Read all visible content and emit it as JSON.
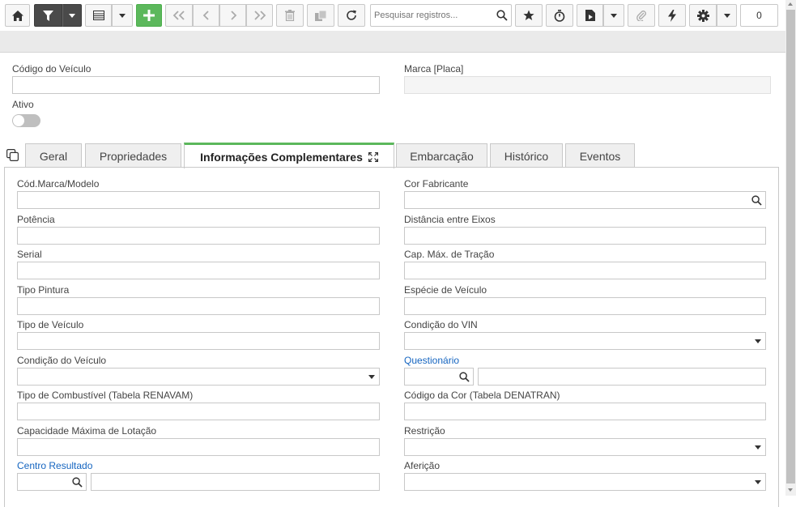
{
  "toolbar": {
    "search_placeholder": "Pesquisar registros...",
    "record_count": "0",
    "icons": [
      "home-icon",
      "filter-icon",
      "list-view-icon",
      "add-icon",
      "first-record-icon",
      "previous-record-icon",
      "next-record-icon",
      "last-record-icon",
      "delete-icon",
      "copy-icon",
      "refresh-icon",
      "search-icon",
      "favorite-star-icon",
      "timer-icon",
      "report-icon",
      "attachment-icon",
      "lightning-icon",
      "gear-icon"
    ]
  },
  "header": {
    "codigo_label": "Código do Veículo",
    "codigo_value": "",
    "marca_label": "Marca [Placa]",
    "marca_value": "",
    "ativo_label": "Ativo"
  },
  "tabs": [
    {
      "label": "Geral"
    },
    {
      "label": "Propriedades"
    },
    {
      "label": "Informações Complementares"
    },
    {
      "label": "Embarcação"
    },
    {
      "label": "Histórico"
    },
    {
      "label": "Eventos"
    }
  ],
  "form": {
    "left": [
      {
        "label": "Cód.Marca/Modelo",
        "value": ""
      },
      {
        "label": "Potência",
        "value": ""
      },
      {
        "label": "Serial",
        "value": ""
      },
      {
        "label": "Tipo Pintura",
        "value": ""
      },
      {
        "label": "Tipo de Veículo",
        "value": ""
      },
      {
        "label": "Condição do Veículo",
        "value": ""
      },
      {
        "label": "Tipo de Combustível (Tabela RENAVAM)",
        "value": ""
      },
      {
        "label": "Capacidade Máxima de Lotação",
        "value": ""
      },
      {
        "label": "Centro Resultado",
        "value": "",
        "desc": ""
      }
    ],
    "right": [
      {
        "label": "Cor Fabricante",
        "value": ""
      },
      {
        "label": "Distância entre Eixos",
        "value": ""
      },
      {
        "label": "Cap. Máx. de Tração",
        "value": ""
      },
      {
        "label": "Espécie de Veículo",
        "value": ""
      },
      {
        "label": "Condição do VIN",
        "value": ""
      },
      {
        "label": "Questionário",
        "value": "",
        "desc": ""
      },
      {
        "label": "Código da Cor (Tabela DENATRAN)",
        "value": ""
      },
      {
        "label": "Restrição",
        "value": ""
      },
      {
        "label": "Aferição",
        "value": ""
      }
    ]
  },
  "colors": {
    "accent": "#5cb85c",
    "link": "#1565c0",
    "toolbar_dark": "#4a4a4a"
  }
}
